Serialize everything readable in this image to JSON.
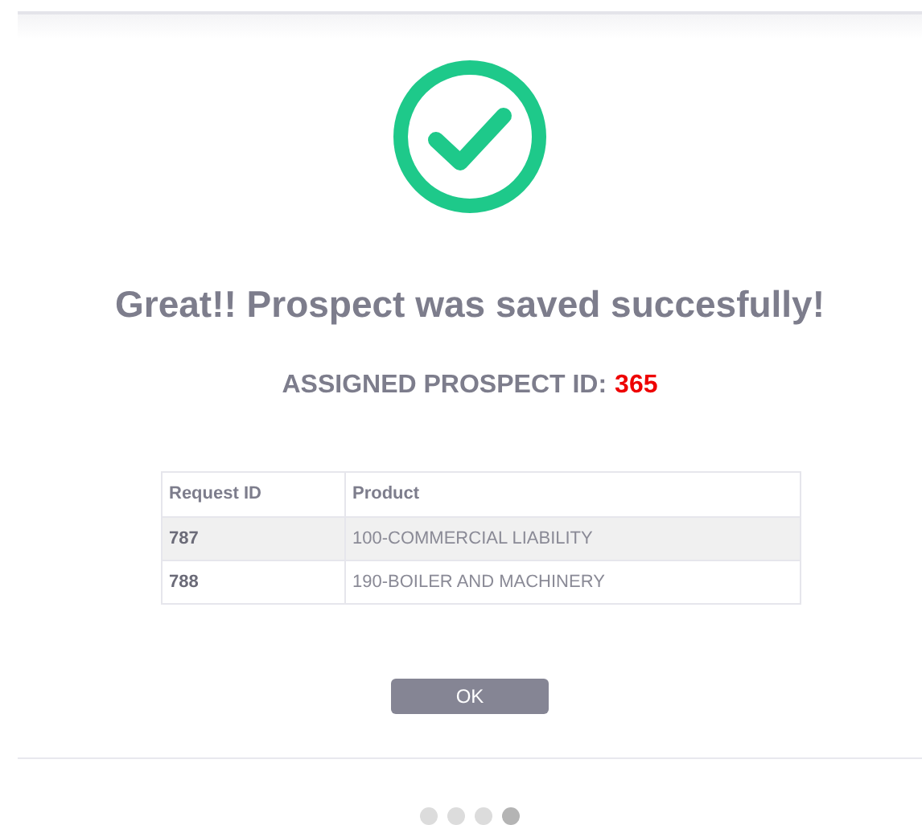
{
  "title": "Great!! Prospect was saved succesfully!",
  "assigned": {
    "label": "ASSIGNED PROSPECT ID:",
    "value": "365"
  },
  "table": {
    "columns": [
      "Request ID",
      "Product"
    ],
    "rows": [
      {
        "request_id": "787",
        "product": "100-COMMERCIAL LIABILITY"
      },
      {
        "request_id": "788",
        "product": "190-BOILER AND MACHINERY"
      }
    ]
  },
  "button": "OK",
  "steps": [
    {
      "selected": false
    },
    {
      "selected": false
    },
    {
      "selected": false
    },
    {
      "selected": true
    }
  ]
}
